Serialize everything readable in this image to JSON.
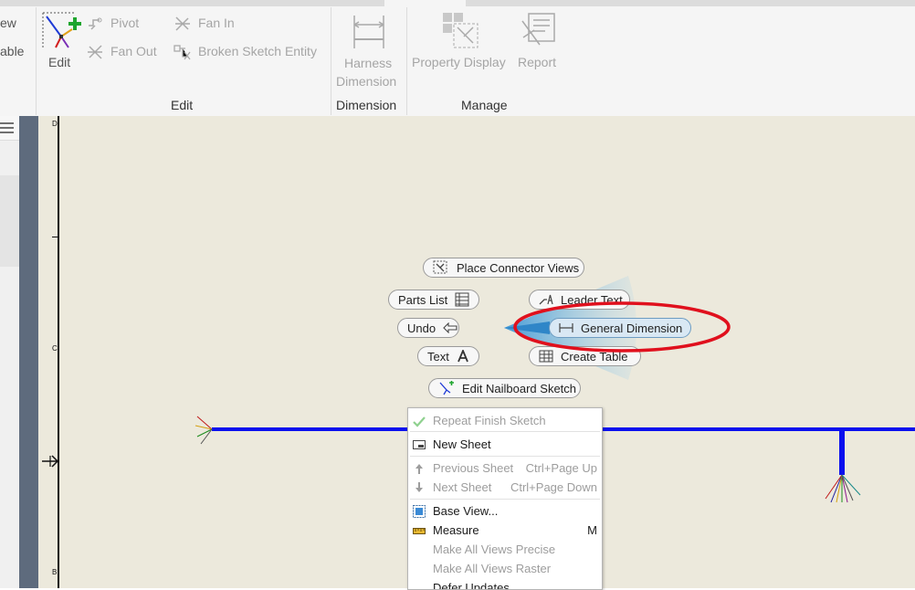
{
  "ribbon": {
    "partial_left_labels": [
      "ew",
      "able"
    ],
    "edit_group": {
      "title": "Edit",
      "edit_label": "Edit",
      "pivot_label": "Pivot",
      "fan_out_label": "Fan Out",
      "fan_in_label": "Fan In",
      "broken_sketch_entity_label": "Broken Sketch Entity"
    },
    "dimension_group": {
      "title": "Dimension",
      "harness_dimension_line1": "Harness",
      "harness_dimension_line2": "Dimension"
    },
    "manage_group": {
      "title": "Manage",
      "property_display_label": "Property Display",
      "report_label": "Report"
    }
  },
  "sheet": {
    "zone_labels": [
      "D",
      "C",
      "B"
    ]
  },
  "marking_menu": {
    "place_connector_views": "Place Connector Views",
    "parts_list": "Parts List",
    "leader_text": "Leader Text",
    "undo": "Undo",
    "general_dimension": "General Dimension",
    "text": "Text",
    "create_table": "Create Table",
    "edit_nailboard_sketch": "Edit Nailboard Sketch"
  },
  "context_menu": {
    "items": [
      {
        "label": "Repeat Finish Sketch",
        "shortcut": "",
        "icon": "check-icon",
        "enabled": false
      },
      {
        "label": "New Sheet",
        "shortcut": "",
        "icon": "new-sheet-icon",
        "enabled": true
      },
      {
        "label": "Previous Sheet",
        "shortcut": "Ctrl+Page Up",
        "icon": "arrow-up-icon",
        "enabled": false
      },
      {
        "label": "Next Sheet",
        "shortcut": "Ctrl+Page Down",
        "icon": "arrow-down-icon",
        "enabled": false
      },
      {
        "label": "Base View...",
        "shortcut": "",
        "icon": "base-view-icon",
        "enabled": true
      },
      {
        "label": "Measure",
        "shortcut": "M",
        "icon": "measure-icon",
        "enabled": true
      },
      {
        "label": "Make All Views Precise",
        "shortcut": "",
        "icon": "",
        "enabled": false
      },
      {
        "label": "Make All Views Raster",
        "shortcut": "",
        "icon": "",
        "enabled": false
      },
      {
        "label": "Defer Updates",
        "shortcut": "",
        "icon": "",
        "enabled": true
      }
    ]
  },
  "colors": {
    "wire": "#0a10ee",
    "highlight_ellipse": "#e0101d",
    "canvas": "#ece9dc",
    "ribbon": "#f5f5f5"
  }
}
